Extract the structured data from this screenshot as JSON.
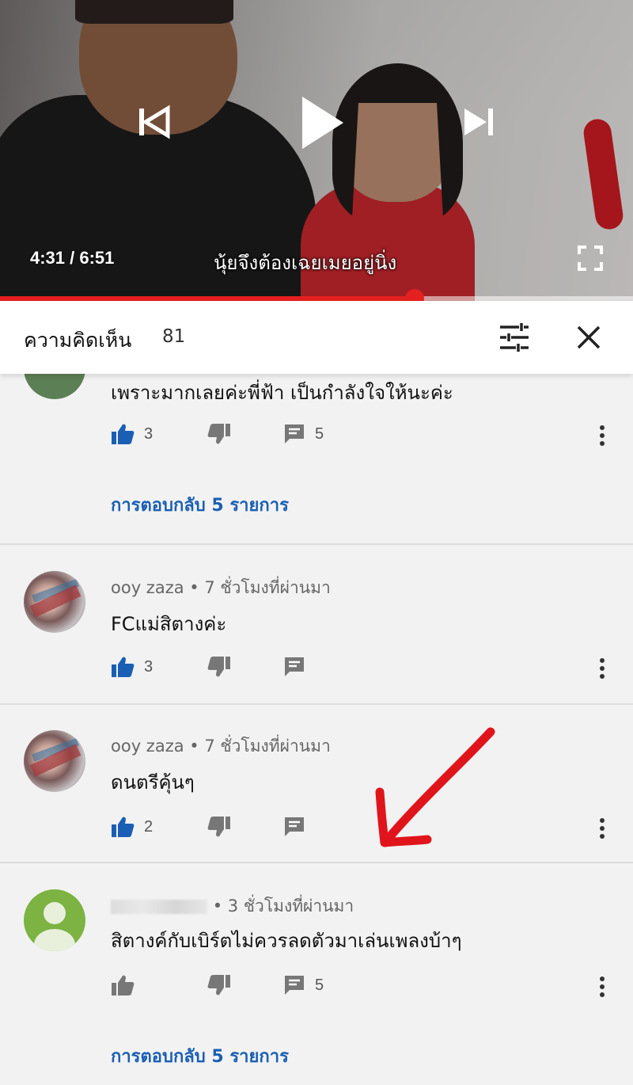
{
  "player": {
    "time": "4:31 / 6:51",
    "subtitle": "นุ้ยจึงต้องเฉยเมยอยู่นิ่ง",
    "progress_fraction": 0.655
  },
  "header": {
    "title": "ความคิดเห็น",
    "count": "81"
  },
  "comments": [
    {
      "author": "",
      "time": "",
      "text": "เพราะมากเลยค่ะพี่ฟ้า เป็นกำลังใจให้นะค่ะ",
      "likes": "3",
      "replies_count": "5",
      "replies_label": "การตอบกลับ 5 รายการ",
      "liked": true
    },
    {
      "author": "ooy zaza",
      "time": "• 7 ชั่วโมงที่ผ่านมา",
      "text": "FCแม่สิตางค่ะ",
      "likes": "3",
      "liked": true
    },
    {
      "author": "ooy zaza",
      "time": "• 7 ชั่วโมงที่ผ่านมา",
      "text": "ดนตรีคุ้นๆ",
      "likes": "2",
      "liked": true
    },
    {
      "author": "",
      "time": "• 3 ชั่วโมงที่ผ่านมา",
      "text": "สิตางค์กับเบิร์ตไม่ควรลดตัวมาเล่นเพลงบ้าๆ",
      "likes": "",
      "replies_count": "5",
      "replies_label": "การตอบกลับ 5 รายการ",
      "liked": false
    }
  ],
  "icons": {
    "like": "thumb-up-icon",
    "dislike": "thumb-down-icon",
    "reply": "comment-icon",
    "more": "more-vert-icon",
    "filter": "tune-icon",
    "close": "close-icon"
  },
  "colors": {
    "accent_blue": "#1a5fb4",
    "progress_red": "#e52020",
    "annotation_red": "#e0151b"
  }
}
